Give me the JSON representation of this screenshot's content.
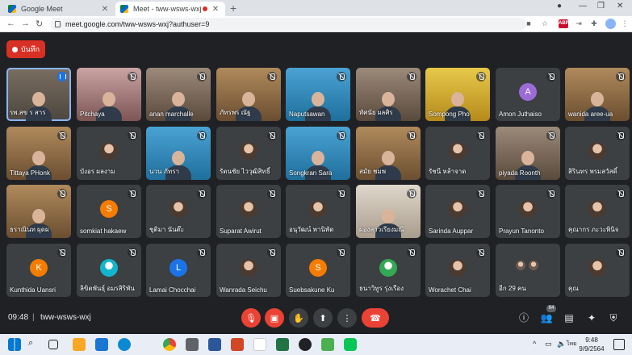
{
  "browser": {
    "tabs": [
      {
        "title": "Google Meet",
        "active": false
      },
      {
        "title": "Meet - tww-wsws-wxj",
        "active": true
      }
    ],
    "address": "meet.google.com/tww-wsws-wxj?authuser=9"
  },
  "record_button": {
    "label": "บันทึก"
  },
  "participants": [
    {
      "name": "รพ.สข ร สาร",
      "style": "video",
      "status": "speaking"
    },
    {
      "name": "Pitchaya",
      "style": "pink",
      "status": "muted"
    },
    {
      "name": "anan marchalle",
      "style": "office",
      "status": "muted"
    },
    {
      "name": "ภัทรพร ณัฐ",
      "style": "warm",
      "status": "muted"
    },
    {
      "name": "Naputsawan",
      "style": "blue",
      "status": "muted"
    },
    {
      "name": "ทัศนัย ผลศิร",
      "style": "office",
      "status": "muted"
    },
    {
      "name": "Sompong Pho",
      "style": "yellow",
      "status": "muted"
    },
    {
      "name": "Amon Juthaiso",
      "style": "avatar",
      "letter": "A",
      "color": "#9c6bd6",
      "status": "muted"
    },
    {
      "name": "wanida aree-ua",
      "style": "warm",
      "status": "muted"
    },
    {
      "name": "Tittaya PHonk",
      "style": "warm",
      "status": "muted"
    },
    {
      "name": "บังอร ผลงาม",
      "style": "avatar-photo",
      "status": "muted"
    },
    {
      "name": "นวน ภัทรา",
      "style": "blue",
      "status": "muted"
    },
    {
      "name": "รัตนชัย ไววุฒิสิทธิ์",
      "style": "avatar-photo",
      "status": "muted"
    },
    {
      "name": "Songkran Sara",
      "style": "blue",
      "status": "muted"
    },
    {
      "name": "สมัย ชมพ",
      "style": "warm",
      "status": "muted"
    },
    {
      "name": "รัชนี หล้าจาด",
      "style": "avatar-photo",
      "status": "muted"
    },
    {
      "name": "piyada Roonth",
      "style": "office",
      "status": "muted"
    },
    {
      "name": "สิรินทร พรมสวัสดิ์",
      "style": "avatar-photo",
      "status": "muted"
    },
    {
      "name": "ธราณินท ผุดผ",
      "style": "warm",
      "status": "muted"
    },
    {
      "name": "somkiat hakaew",
      "style": "avatar",
      "letter": "S",
      "color": "#f57c00",
      "status": "muted"
    },
    {
      "name": "ชุติมา นันต๊ะ",
      "style": "avatar-photo",
      "status": "muted"
    },
    {
      "name": "Suparat Awirut",
      "style": "avatar-photo",
      "status": "muted"
    },
    {
      "name": "อนุวัฒน์ พานิพัด",
      "style": "avatar-photo",
      "status": "muted"
    },
    {
      "name": "ผองสาวเรียงมณี",
      "style": "light",
      "status": "muted"
    },
    {
      "name": "Sarinda Auppar",
      "style": "avatar-photo",
      "status": "muted"
    },
    {
      "name": "Prayun Tanonto",
      "style": "avatar-photo",
      "status": "muted"
    },
    {
      "name": "คุณากร ภะวะพินิจ",
      "style": "avatar-photo",
      "status": "muted"
    },
    {
      "name": "Kunthida Uansri",
      "style": "avatar",
      "letter": "K",
      "color": "#f57c00",
      "status": "muted"
    },
    {
      "name": "ลิขิตพันธุ์ อมรสิริพัน",
      "style": "avatar",
      "letter": "",
      "color": "#12b5cb",
      "status": "muted"
    },
    {
      "name": "Lamai Chocchai",
      "style": "avatar",
      "letter": "L",
      "color": "#1a73e8",
      "status": "muted"
    },
    {
      "name": "Wanrada Seichu",
      "style": "avatar-photo",
      "status": "muted"
    },
    {
      "name": "Suebsakune Ku",
      "style": "avatar",
      "letter": "S",
      "color": "#f57c00",
      "status": "muted"
    },
    {
      "name": "ธนาวิทูร รุ่งเรือง",
      "style": "avatar",
      "letter": "",
      "color": "#34a853",
      "status": "muted"
    },
    {
      "name": "Worachet Chai",
      "style": "avatar-photo",
      "status": "muted"
    },
    {
      "name": "อีก 29 คน",
      "style": "more",
      "status": "none"
    },
    {
      "name": "คุณ",
      "style": "avatar-photo",
      "status": "muted"
    }
  ],
  "bottom_bar": {
    "time": "09:48",
    "separator": "|",
    "meeting_code": "tww-wsws-wxj",
    "people_count": "64"
  },
  "taskbar": {
    "time": "9:48",
    "date": "9/9/2564",
    "lang": "ไทย"
  },
  "colors": {
    "meet_bg": "#202124",
    "tile_bg": "#3c4043",
    "red": "#ea4335"
  }
}
